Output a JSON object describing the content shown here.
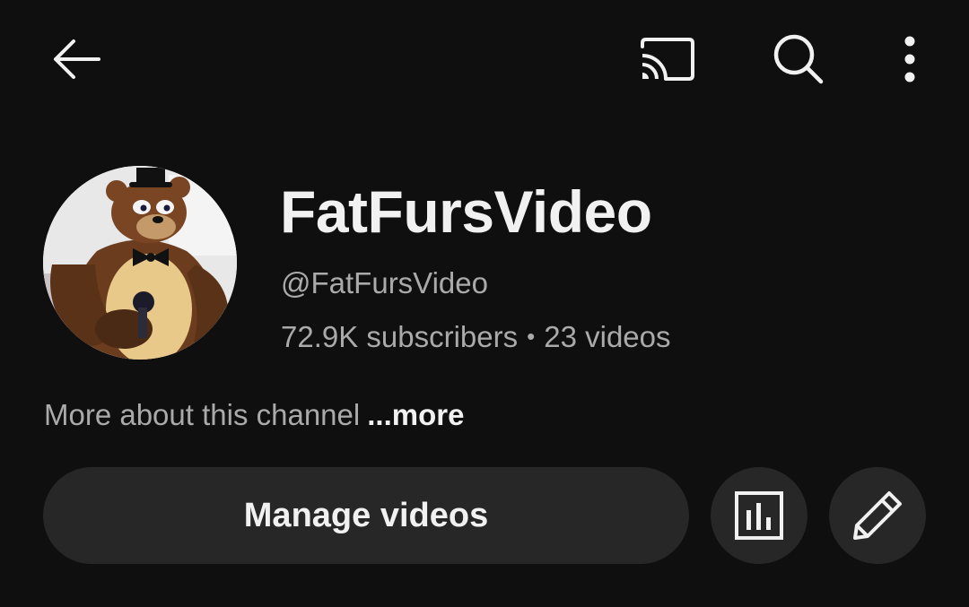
{
  "toolbar": {
    "back_icon": "arrow-back-icon",
    "cast_icon": "cast-icon",
    "search_icon": "search-icon",
    "more_icon": "more-vert-icon"
  },
  "channel": {
    "name": "FatFursVideo",
    "handle": "@FatFursVideo",
    "subscribers": "72.9K subscribers",
    "separator": "•",
    "videos": "23 videos",
    "about_text": "More about this channel",
    "more_link": "...more"
  },
  "actions": {
    "manage_label": "Manage videos",
    "analytics_icon": "analytics-icon",
    "edit_icon": "pencil-icon"
  },
  "colors": {
    "background": "#0f0f0f",
    "primary_text": "#f1f1f1",
    "secondary_text": "#aaaaaa",
    "button_bg": "#272727"
  }
}
